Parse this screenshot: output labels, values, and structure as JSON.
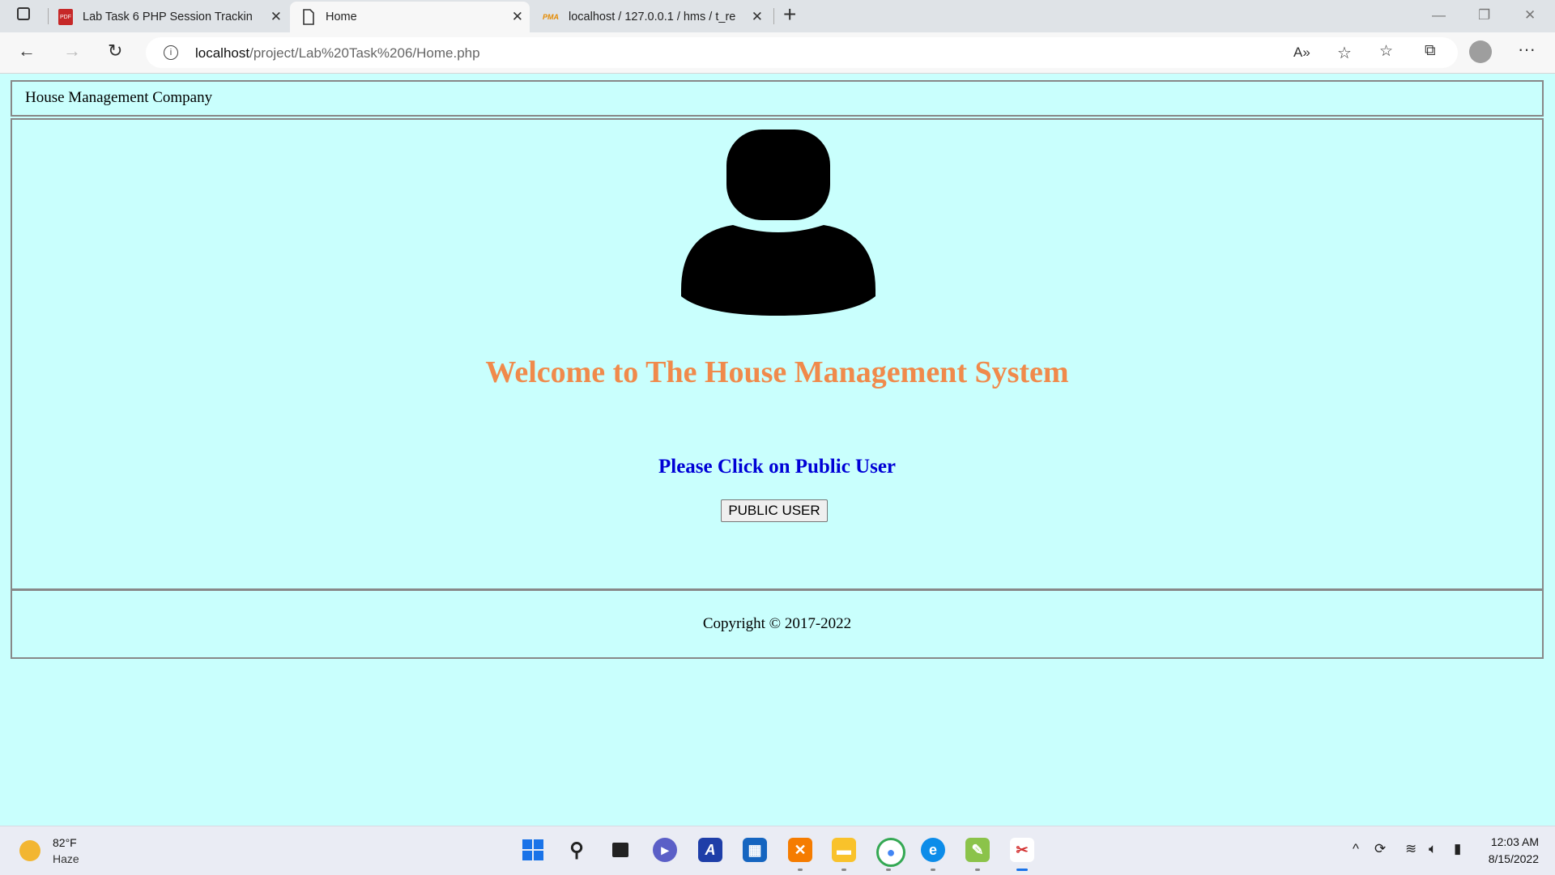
{
  "browser": {
    "tabs": [
      {
        "title": "Lab Task 6 PHP Session Tracking",
        "icon": "pdf-icon"
      },
      {
        "title": "Home",
        "icon": "page-icon"
      },
      {
        "title": "localhost / 127.0.0.1 / hms / t_re",
        "icon": "phpmyadmin-icon"
      }
    ],
    "new_tab": "+",
    "url_host": "localhost",
    "url_path": "/project/Lab%20Task%206/Home.php"
  },
  "page": {
    "header_title": "House Management Company",
    "welcome": "Welcome to The House Management System",
    "prompt": "Please Click on Public User",
    "public_user_button": "PUBLIC USER",
    "copyright": "Copyright © 2017-2022"
  },
  "taskbar": {
    "weather_temp": "82°F",
    "weather_desc": "Haze",
    "time": "12:03 AM",
    "date": "8/15/2022"
  },
  "colors": {
    "page_bg": "#c9fffd",
    "welcome": "#f08a4b",
    "prompt": "#0000d6"
  }
}
